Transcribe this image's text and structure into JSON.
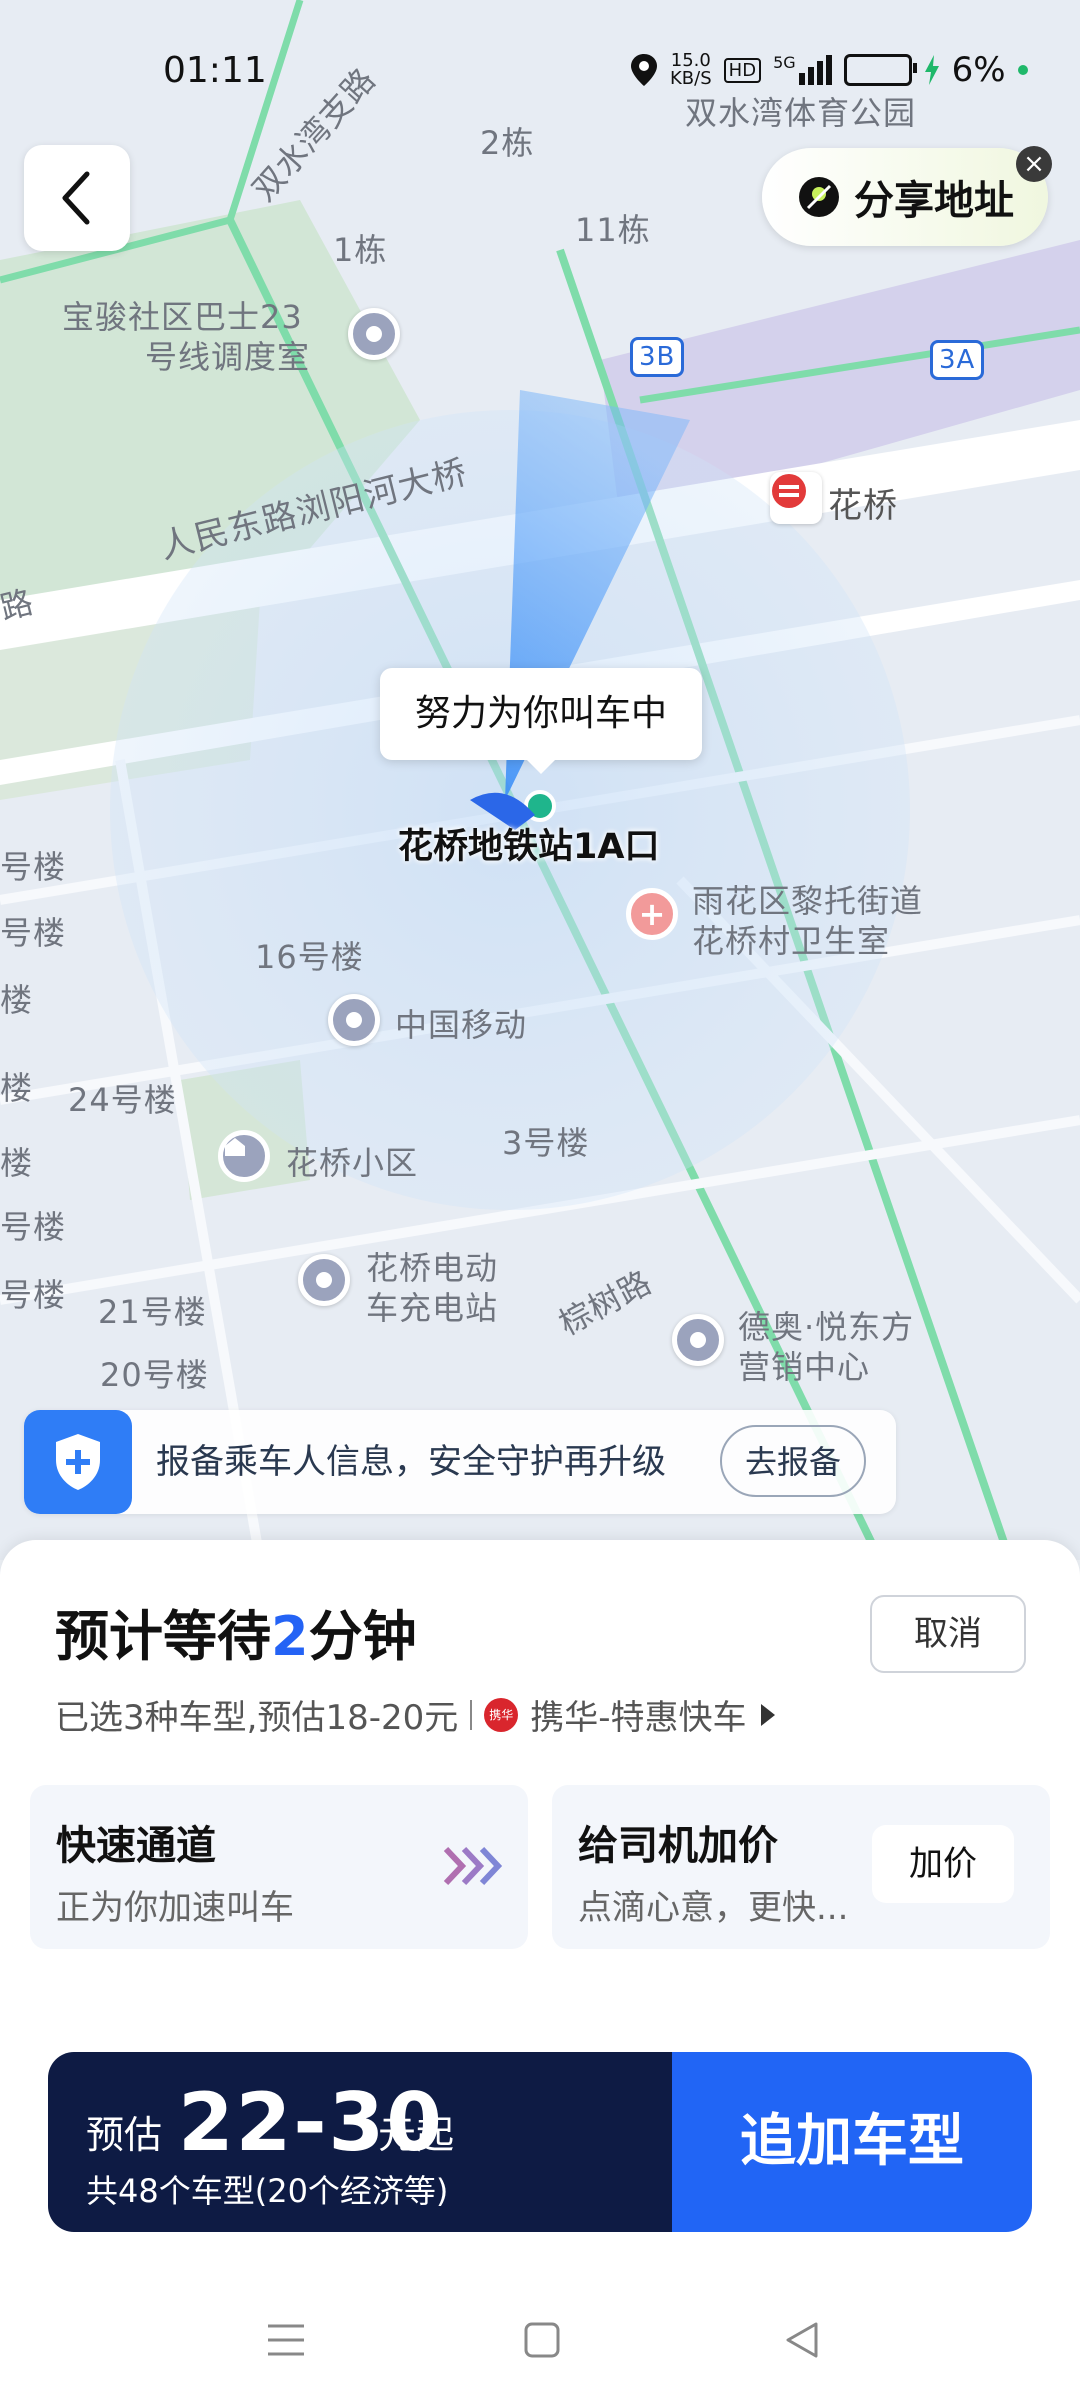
{
  "status_bar": {
    "time": "01:11",
    "net_speed": "15.0",
    "net_unit": "KB/S",
    "hd": "HD",
    "signal": "5G",
    "battery": "6%"
  },
  "map": {
    "labels": {
      "shuangshuiwan_road": "双水湾支路",
      "shuangshuiwan_park": "双水湾体育公园",
      "building2": "2栋",
      "building1": "1栋",
      "building11": "11栋",
      "bus_station_l1": "宝骏社区巴士23",
      "bus_station_l2": "号线调度室",
      "exit_3b": "3B",
      "exit_3a": "3A",
      "huaqiao_metro": "花桥",
      "renmin_road": "人民东路浏阳河大桥",
      "road_left": "路",
      "clinic_l1": "雨花区黎托街道",
      "clinic_l2": "花桥村卫生室",
      "building16": "16号楼",
      "china_mobile": "中国移动",
      "building24": "24号楼",
      "huaqiao_community": "花桥小区",
      "building3": "3号楼",
      "charging_l1": "花桥电动",
      "charging_l2": "车充电站",
      "zongshu_road": "棕树路",
      "building21": "21号楼",
      "building20": "20号楼",
      "deao_l1": "德奥·悦东方",
      "deao_l2": "营销中心",
      "edge_a": "号楼",
      "edge_b": "号楼",
      "edge_c": "楼",
      "edge_d": "楼",
      "edge_e": "楼",
      "edge_f": "号楼",
      "edge_g": "号楼"
    },
    "bubble": "努力为你叫车中",
    "location_name": "花桥地铁站1A口"
  },
  "share": {
    "label": "分享地址"
  },
  "safety_banner": {
    "text": "报备乘车人信息，安全守护再升级",
    "button": "去报备"
  },
  "panel": {
    "wait_prefix": "预计等待",
    "wait_num": "2",
    "wait_suffix": "分钟",
    "cancel": "取消",
    "selected_info": "已选3种车型,预估18-20元",
    "brand_logo_text": "携华",
    "brand_name": "携华-特惠快车",
    "fast_card": {
      "title": "快速通道",
      "sub": "正为你加速叫车"
    },
    "tip_card": {
      "title": "给司机加价",
      "sub": "点滴心意，更快...",
      "button": "加价"
    }
  },
  "price_bar": {
    "prefix": "预估",
    "amount": "22-30",
    "unit": "元起",
    "count": "共48个车型(20个经济等)",
    "action": "追加车型"
  },
  "colors": {
    "accent": "#2165f5",
    "price_dark": "#0e1b44",
    "road_green": "#6fd7a0",
    "rail_purple": "#c9c5e8"
  }
}
